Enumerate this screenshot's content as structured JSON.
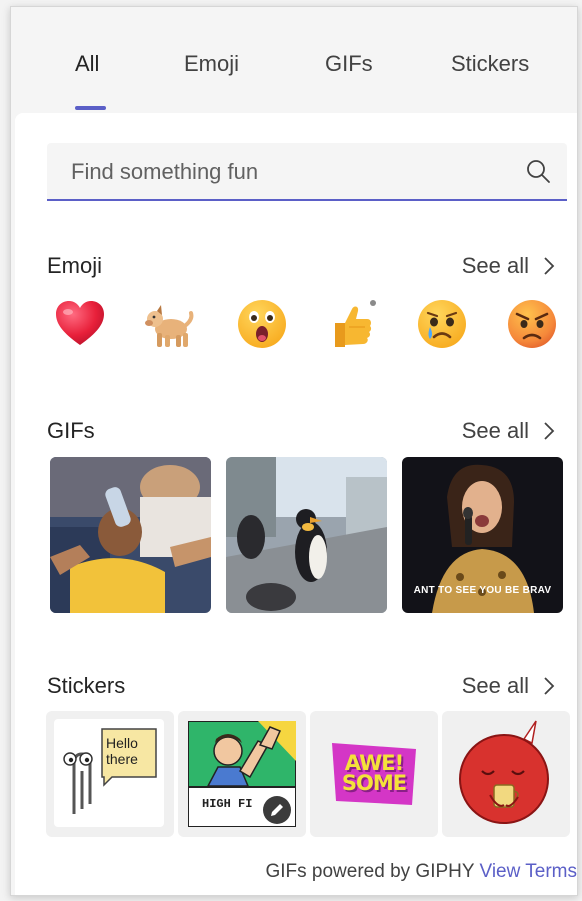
{
  "tabs": [
    {
      "label": "All",
      "active": true
    },
    {
      "label": "Emoji",
      "active": false
    },
    {
      "label": "GIFs",
      "active": false
    },
    {
      "label": "Stickers",
      "active": false
    }
  ],
  "search": {
    "placeholder": "Find something fun",
    "value": "",
    "icon": "search-icon"
  },
  "emoji_section": {
    "title": "Emoji",
    "see_all": "See all",
    "items": [
      "heart",
      "dog",
      "surprised-face",
      "thumbs-up",
      "crying-face",
      "angry-face"
    ]
  },
  "gifs_section": {
    "title": "GIFs",
    "see_all": "See all",
    "items": [
      {
        "name": "child-drinking-gif"
      },
      {
        "name": "penguin-walking-gif"
      },
      {
        "name": "singer-gif",
        "caption": "ANT TO SEE YOU BE BRAV"
      }
    ]
  },
  "stickers_section": {
    "title": "Stickers",
    "see_all": "See all",
    "items": [
      {
        "name": "clippy-sticker",
        "text": "Hello there"
      },
      {
        "name": "high-five-sticker",
        "text": "HIGH FI"
      },
      {
        "name": "awesome-sticker",
        "text": "AWE! SOME"
      },
      {
        "name": "red-creature-sticker"
      }
    ]
  },
  "footer": {
    "text": "GIFs powered by GIPHY",
    "link": "View Terms"
  },
  "colors": {
    "accent": "#5b5fc7",
    "panel": "#ffffff",
    "background": "#f5f5f5"
  }
}
